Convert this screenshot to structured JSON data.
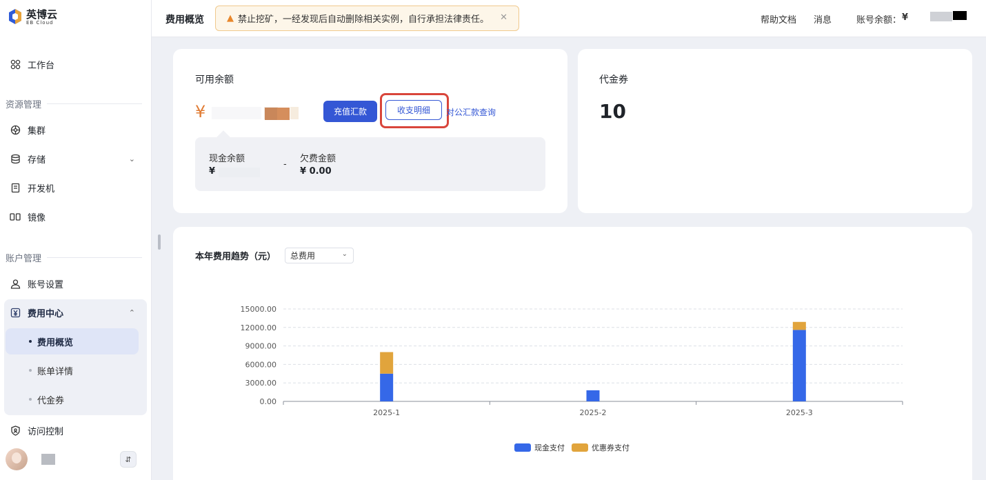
{
  "brand": {
    "name": "英博云",
    "sub": "EB Cloud"
  },
  "sidebar": {
    "workbench": "工作台",
    "section_resources": "资源管理",
    "resources": [
      {
        "label": "集群",
        "icon": "cluster-icon"
      },
      {
        "label": "存储",
        "icon": "database-icon"
      },
      {
        "label": "开发机",
        "icon": "devbox-icon"
      },
      {
        "label": "镜像",
        "icon": "image-icon"
      }
    ],
    "section_account": "账户管理",
    "account_settings": "账号设置",
    "billing_center": "费用中心",
    "billing_sub": [
      "费用概览",
      "账单详情",
      "代金券"
    ],
    "access_control": "访问控制"
  },
  "header": {
    "title": "费用概览",
    "alert": "禁止挖矿，一经发现后自动删除相关实例，自行承担法律责任。",
    "help": "帮助文档",
    "messages": "消息",
    "balance_label": "账号余额：",
    "currency": "¥"
  },
  "balance_card": {
    "title": "可用余额",
    "currency": "¥",
    "recharge_button": "充值汇款",
    "details_button": "收支明细",
    "corporate_link": "对公汇款查询",
    "cash_label": "现金余额",
    "cash_value": "¥",
    "separator": "-",
    "arrears_label": "欠费金额",
    "arrears_value": "¥ 0.00"
  },
  "voucher_card": {
    "title": "代金券",
    "value": "10"
  },
  "trend": {
    "title": "本年费用趋势（元）",
    "select_value": "总费用"
  },
  "colors": {
    "primary": "#3457d5",
    "cash": "#3568e8",
    "coupon": "#e1a43c",
    "alert_border": "#f0c98d",
    "highlight": "#d9453b"
  },
  "chart_data": {
    "type": "bar",
    "stacked": true,
    "categories": [
      "2025-1",
      "2025-2",
      "2025-3"
    ],
    "series": [
      {
        "name": "现金支付",
        "values": [
          4500,
          1800,
          11600
        ]
      },
      {
        "name": "优惠券支付",
        "values": [
          3500,
          0,
          1300
        ]
      }
    ],
    "yticks": [
      "0.00",
      "3000.00",
      "6000.00",
      "9000.00",
      "12000.00",
      "15000.00"
    ],
    "ylim": [
      0,
      15000
    ],
    "grid": true,
    "legend": "bottom-center"
  }
}
